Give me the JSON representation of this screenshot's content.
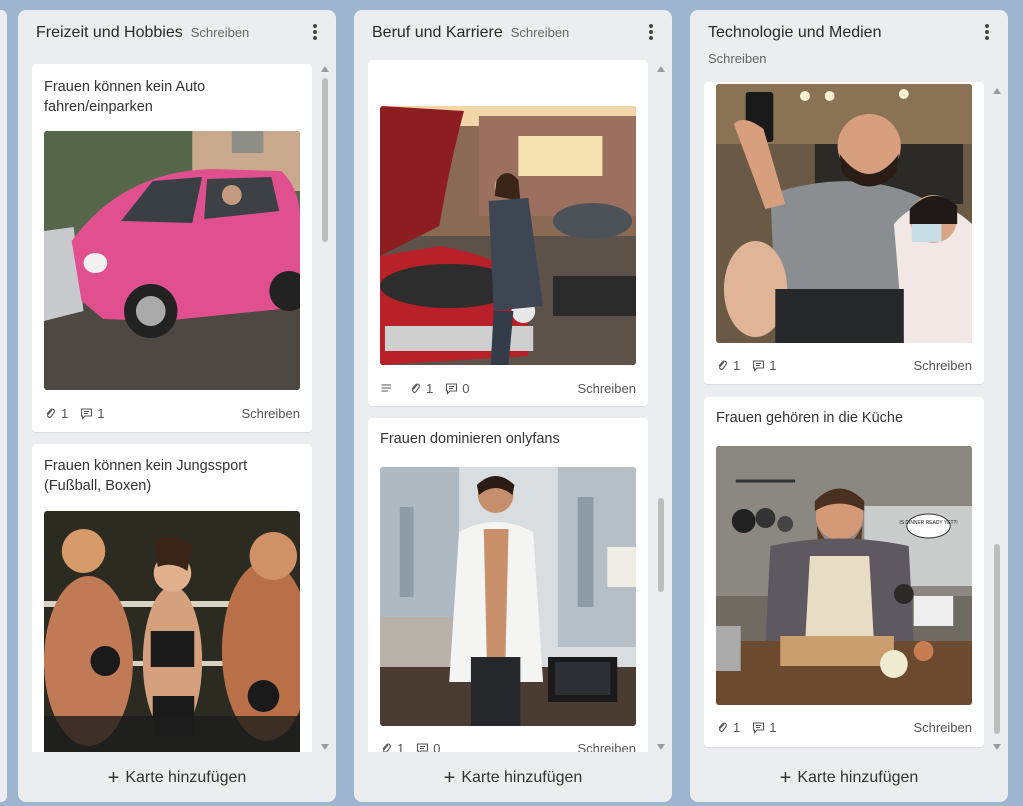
{
  "columns": [
    {
      "title": "Freizeit und Hobbies",
      "write_label": "Schreiben",
      "add_card_label": "Karte hinzufügen",
      "cards": [
        {
          "title": "Frauen können kein Auto fahren/einparken",
          "image": "pink-car-crash-photo",
          "attachments": "1",
          "comments": "1",
          "write_label": "Schreiben"
        },
        {
          "title": "Frauen können kein Jungssport (Fußball, Boxen)",
          "image": "boxing-ring-photo"
        }
      ]
    },
    {
      "title": "Beruf und Karriere",
      "write_label": "Schreiben",
      "add_card_label": "Karte hinzufügen",
      "cards": [
        {
          "image": "woman-repairing-car-photo",
          "attachments": "1",
          "comments": "0",
          "write_label": "Schreiben"
        },
        {
          "title": "Frauen dominieren onlyfans",
          "image": "man-with-open-shirt-photo",
          "attachments": "1",
          "comments": "0",
          "write_label": "Schreiben"
        }
      ]
    },
    {
      "title": "Technologie und Medien",
      "write_label": "Schreiben",
      "add_card_label": "Karte hinzufügen",
      "cards": [
        {
          "image": "man-taking-selfie-pedicure-photo",
          "attachments": "1",
          "comments": "1",
          "write_label": "Schreiben"
        },
        {
          "title": "Frauen gehören in die Küche",
          "image": "crying-man-cooking-photo",
          "bubble_text": "IS DINNER READY YET?!",
          "attachments": "1",
          "comments": "1",
          "write_label": "Schreiben"
        }
      ]
    }
  ],
  "colors": {
    "board_bg": "#9db5cf",
    "column_bg": "#ebedf0",
    "card_bg": "#ffffff",
    "car_pink": "#e0508f",
    "car_red": "#b8202a"
  }
}
